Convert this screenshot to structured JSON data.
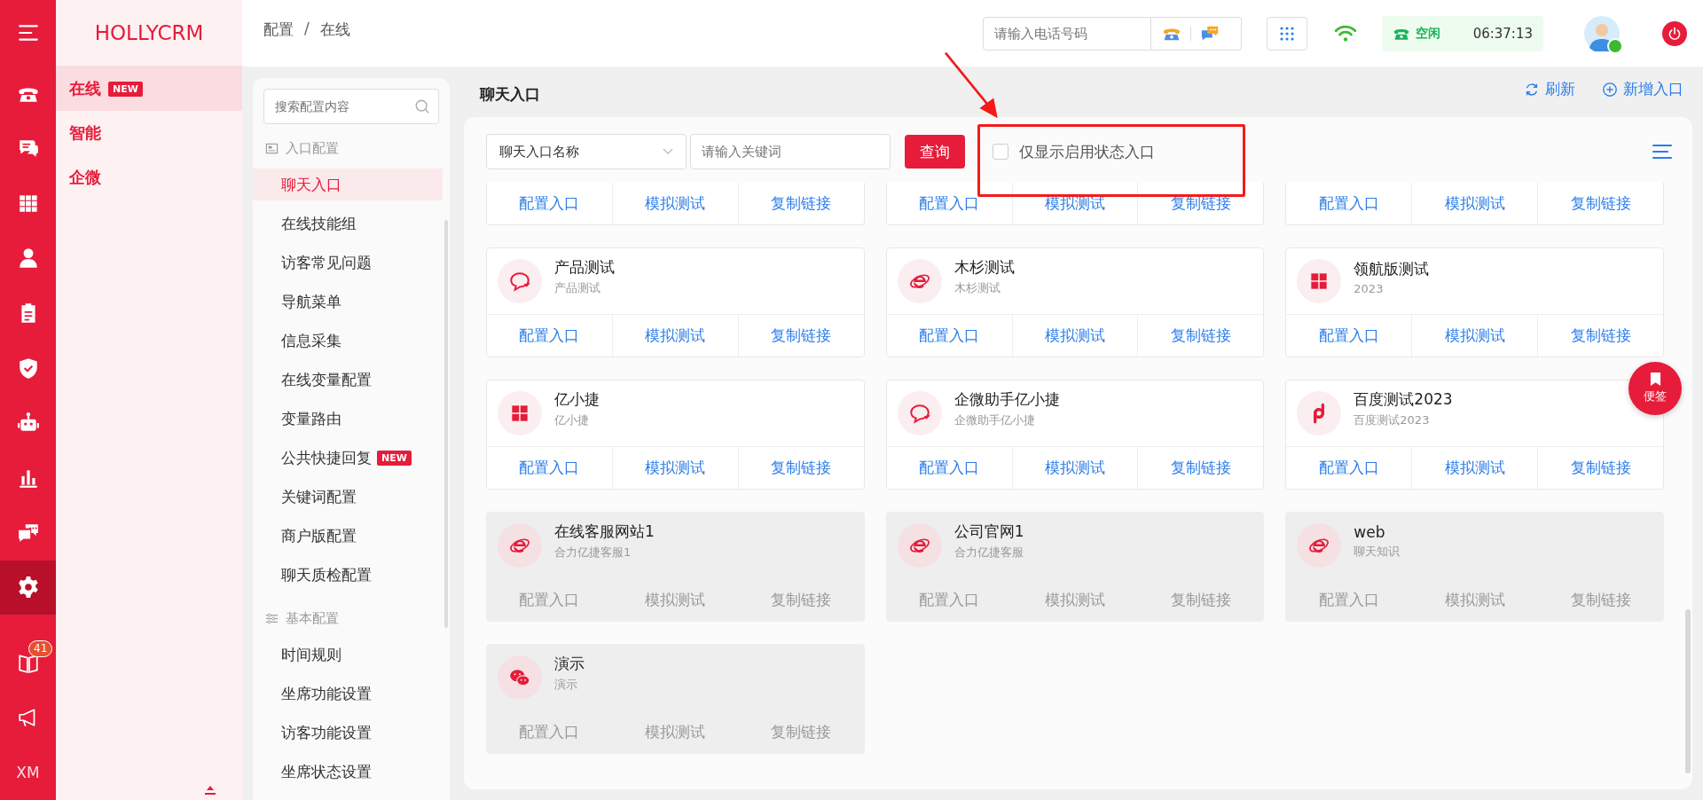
{
  "rail": {
    "items": [
      {
        "kind": "menu",
        "selected": false
      },
      {
        "kind": "phone",
        "selected": false
      },
      {
        "kind": "chat",
        "selected": false
      },
      {
        "kind": "grid",
        "selected": false
      },
      {
        "kind": "person",
        "selected": false
      },
      {
        "kind": "clipboard",
        "selected": false
      },
      {
        "kind": "shield",
        "selected": false
      },
      {
        "kind": "robot",
        "selected": false
      },
      {
        "kind": "chart",
        "selected": false
      },
      {
        "kind": "messages",
        "selected": false
      },
      {
        "kind": "gear",
        "selected": true
      },
      {
        "kind": "book",
        "selected": false,
        "badge": "41"
      },
      {
        "kind": "megaphone",
        "selected": false
      },
      {
        "kind": "text",
        "selected": false,
        "label": "XM"
      }
    ]
  },
  "brand": "HOLLYCRM",
  "modules": [
    {
      "label": "在线",
      "badge": "NEW",
      "selected": true
    },
    {
      "label": "智能",
      "selected": false
    },
    {
      "label": "企微",
      "selected": false
    }
  ],
  "breadcrumb": [
    "配置",
    "在线"
  ],
  "breadcrumb_separator": "/",
  "topbar": {
    "phone_placeholder": "请输入电话号码",
    "status": "空闲",
    "timer": "06:37:13",
    "online": true
  },
  "config_menu": {
    "search_placeholder": "搜索配置内容",
    "groups": [
      {
        "kind": "entry",
        "label": "入口配置",
        "items": [
          {
            "label": "聊天入口",
            "selected": true
          },
          {
            "label": "在线技能组",
            "selected": false
          },
          {
            "label": "访客常见问题",
            "selected": false
          },
          {
            "label": "导航菜单",
            "selected": false
          },
          {
            "label": "信息采集",
            "selected": false
          },
          {
            "label": "在线变量配置",
            "selected": false
          },
          {
            "label": "变量路由",
            "selected": false
          },
          {
            "label": "公共快捷回复",
            "selected": false,
            "badge": "NEW"
          },
          {
            "label": "关键词配置",
            "selected": false
          },
          {
            "label": "商户版配置",
            "selected": false
          },
          {
            "label": "聊天质检配置",
            "selected": false
          }
        ]
      },
      {
        "kind": "basic",
        "label": "基本配置",
        "items": [
          {
            "label": "时间规则",
            "selected": false
          },
          {
            "label": "坐席功能设置",
            "selected": false
          },
          {
            "label": "访客功能设置",
            "selected": false
          },
          {
            "label": "坐席状态设置",
            "selected": false
          }
        ]
      }
    ]
  },
  "page": {
    "title": "聊天入口",
    "actions": [
      {
        "kind": "refresh",
        "label": "刷新"
      },
      {
        "kind": "add",
        "label": "新增入口"
      }
    ]
  },
  "filter": {
    "select_value": "聊天入口名称",
    "keyword_placeholder": "请输入关键词",
    "search_button": "查询",
    "only_enabled": {
      "label": "仅显示启用状态入口",
      "checked": false
    }
  },
  "cards": [
    {
      "enabled": true,
      "actions": [
        "配置入口",
        "模拟测试",
        "复制链接"
      ]
    },
    {
      "enabled": true,
      "actions": [
        "配置入口",
        "模拟测试",
        "复制链接"
      ]
    },
    {
      "enabled": true,
      "actions": [
        "配置入口",
        "模拟测试",
        "复制链接"
      ]
    },
    {
      "enabled": true,
      "kind": "chat",
      "name": "产品测试",
      "desc": "产品测试",
      "actions": [
        "配置入口",
        "模拟测试",
        "复制链接"
      ]
    },
    {
      "enabled": true,
      "kind": "ie",
      "name": "木杉测试",
      "desc": "木杉测试",
      "actions": [
        "配置入口",
        "模拟测试",
        "复制链接"
      ]
    },
    {
      "enabled": true,
      "kind": "windows",
      "name": "领航版测试",
      "desc": "2023",
      "actions": [
        "配置入口",
        "模拟测试",
        "复制链接"
      ]
    },
    {
      "enabled": true,
      "kind": "windows",
      "name": "亿小捷",
      "desc": "亿小捷",
      "actions": [
        "配置入口",
        "模拟测试",
        "复制链接"
      ]
    },
    {
      "enabled": true,
      "kind": "chat",
      "name": "企微助手亿小捷",
      "desc": "企微助手亿小捷",
      "actions": [
        "配置入口",
        "模拟测试",
        "复制链接"
      ]
    },
    {
      "enabled": true,
      "kind": "link",
      "name": "百度测试2023",
      "desc": "百度测试2023",
      "actions": [
        "配置入口",
        "模拟测试",
        "复制链接"
      ]
    },
    {
      "enabled": false,
      "kind": "ie",
      "name": "在线客服网站1",
      "desc": "合力亿捷客服1",
      "actions": [
        "配置入口",
        "模拟测试",
        "复制链接"
      ]
    },
    {
      "enabled": false,
      "kind": "ie",
      "name": "公司官网1",
      "desc": "合力亿捷客服",
      "actions": [
        "配置入口",
        "模拟测试",
        "复制链接"
      ]
    },
    {
      "enabled": false,
      "kind": "ie",
      "name": "web",
      "desc": "聊天知识",
      "actions": [
        "配置入口",
        "模拟测试",
        "复制链接"
      ]
    },
    {
      "enabled": false,
      "kind": "wechat",
      "name": "演示",
      "desc": "演示",
      "actions": [
        "配置入口",
        "模拟测试",
        "复制链接"
      ]
    }
  ],
  "note_button": "便签"
}
